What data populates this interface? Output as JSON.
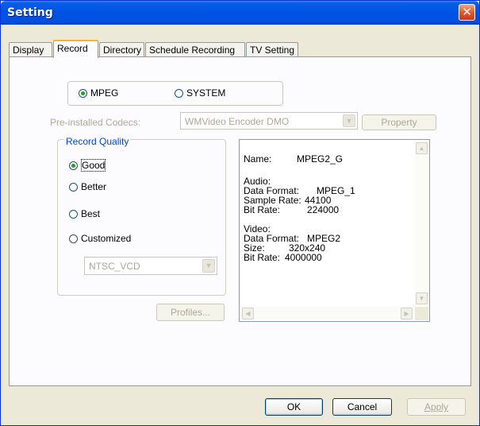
{
  "window": {
    "title": "Setting"
  },
  "tabs": [
    "Display",
    "Record",
    "Directory",
    "Schedule Recording",
    "TV Setting"
  ],
  "active_tab": "Record",
  "mode": {
    "options": [
      "MPEG",
      "SYSTEM"
    ],
    "selected": "MPEG"
  },
  "codecs": {
    "label": "Pre-installed Codecs:",
    "value": "WMVideo Encoder DMO",
    "property_button": "Property"
  },
  "record_quality": {
    "title": "Record Quality",
    "options": [
      "Good",
      "Better",
      "Best",
      "Customized"
    ],
    "selected": "Good",
    "preset": "NTSC_VCD",
    "profiles_button": "Profiles..."
  },
  "info": {
    "name_label": "Name:",
    "name_value": "MPEG2_G",
    "audio_title": "Audio:",
    "audio_format_label": "Data Format:",
    "audio_format_value": "MPEG_1",
    "sample_rate_label": "Sample Rate:",
    "sample_rate_value": "44100",
    "audio_bitrate_label": "Bit Rate:",
    "audio_bitrate_value": "224000",
    "video_title": "Video:",
    "video_format_label": "Data Format:",
    "video_format_value": "MPEG2",
    "size_label": "Size:",
    "size_value": "320x240",
    "video_bitrate_label": "Bit Rate:",
    "video_bitrate_value": "4000000"
  },
  "buttons": {
    "ok": "OK",
    "cancel": "Cancel",
    "apply": "Apply"
  }
}
